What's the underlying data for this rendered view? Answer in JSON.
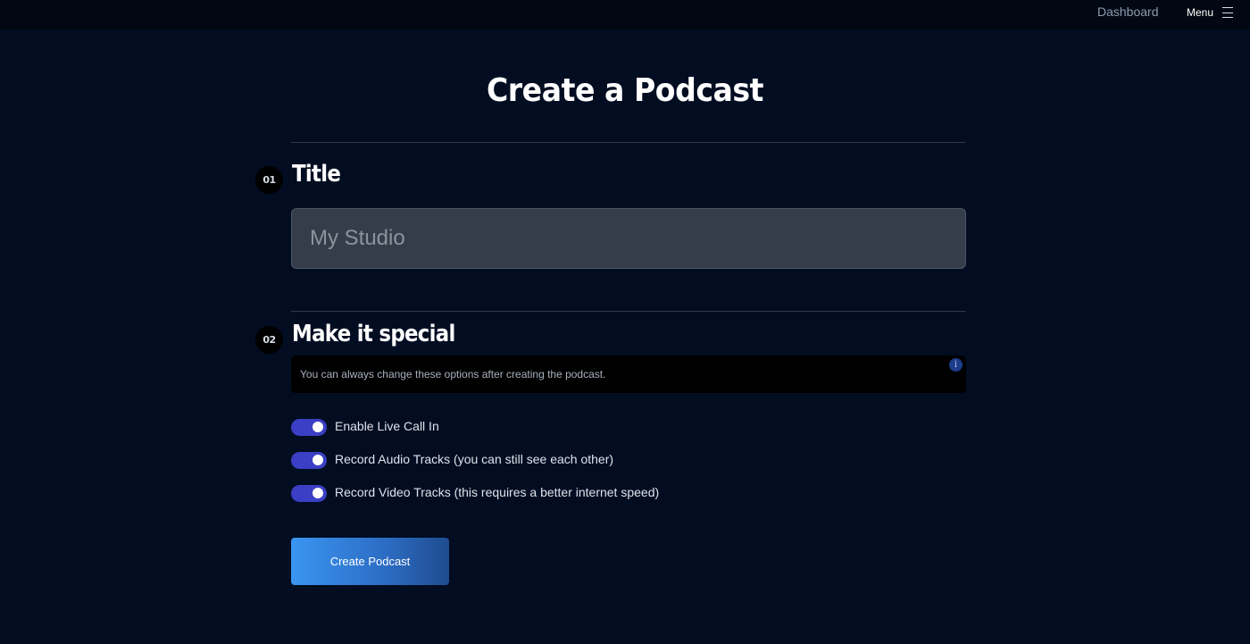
{
  "nav": {
    "dashboard_label": "Dashboard",
    "menu_label": "Menu"
  },
  "page": {
    "title": "Create a Podcast"
  },
  "sections": {
    "title": {
      "step": "01",
      "heading": "Title",
      "input_placeholder": "My Studio",
      "input_value": ""
    },
    "special": {
      "step": "02",
      "heading": "Make it special",
      "info_text": "You can always change these options after creating the podcast.",
      "info_icon": "i",
      "options": [
        {
          "label": "Enable Live Call In",
          "enabled": true
        },
        {
          "label": "Record Audio Tracks (you can still see each other)",
          "enabled": true
        },
        {
          "label": "Record Video Tracks (this requires a better internet speed)",
          "enabled": true
        }
      ]
    }
  },
  "actions": {
    "create_label": "Create Podcast"
  },
  "colors": {
    "background": "#020d22",
    "topbar": "#010813",
    "toggle_on": "#3b3fc5",
    "button_start": "#3a95f0",
    "button_end": "#1f4c8e"
  }
}
